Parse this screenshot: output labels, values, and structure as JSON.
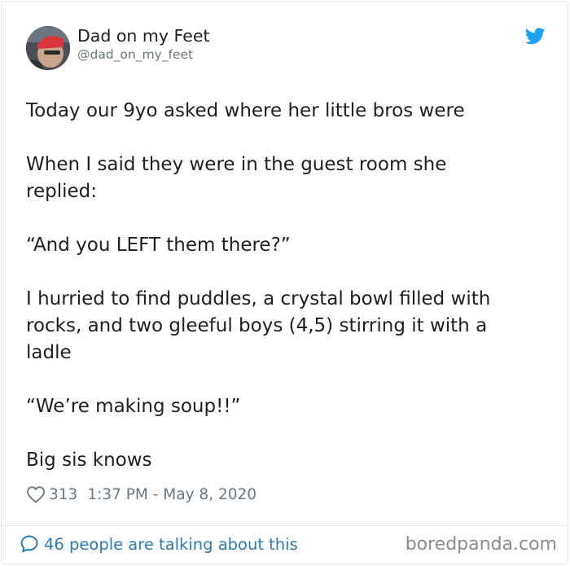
{
  "tweet": {
    "display_name": "Dad on my Feet",
    "handle": "@dad_on_my_feet",
    "paragraphs": [
      "Today our 9yo asked where her little bros were",
      "When I said they were in the guest room she replied:",
      "“And you LEFT them there?”",
      "I hurried to find puddles, a crystal bowl filled with rocks, and two gleeful boys (4,5) stirring it with a ladle",
      "“We’re making soup!!”",
      "Big sis knows"
    ],
    "likes": "313",
    "timestamp": "1:37 PM - May 8, 2020",
    "conversation_link": "46 people are talking about this"
  },
  "watermark": "boredpanda.com",
  "colors": {
    "twitter_blue": "#1da1f2",
    "link_blue": "#2b7bb9",
    "muted_text": "#697882",
    "border": "#e1e8ed"
  },
  "icons": {
    "brand": "twitter-bird-icon",
    "like": "heart-icon",
    "reply": "speech-bubble-icon"
  }
}
